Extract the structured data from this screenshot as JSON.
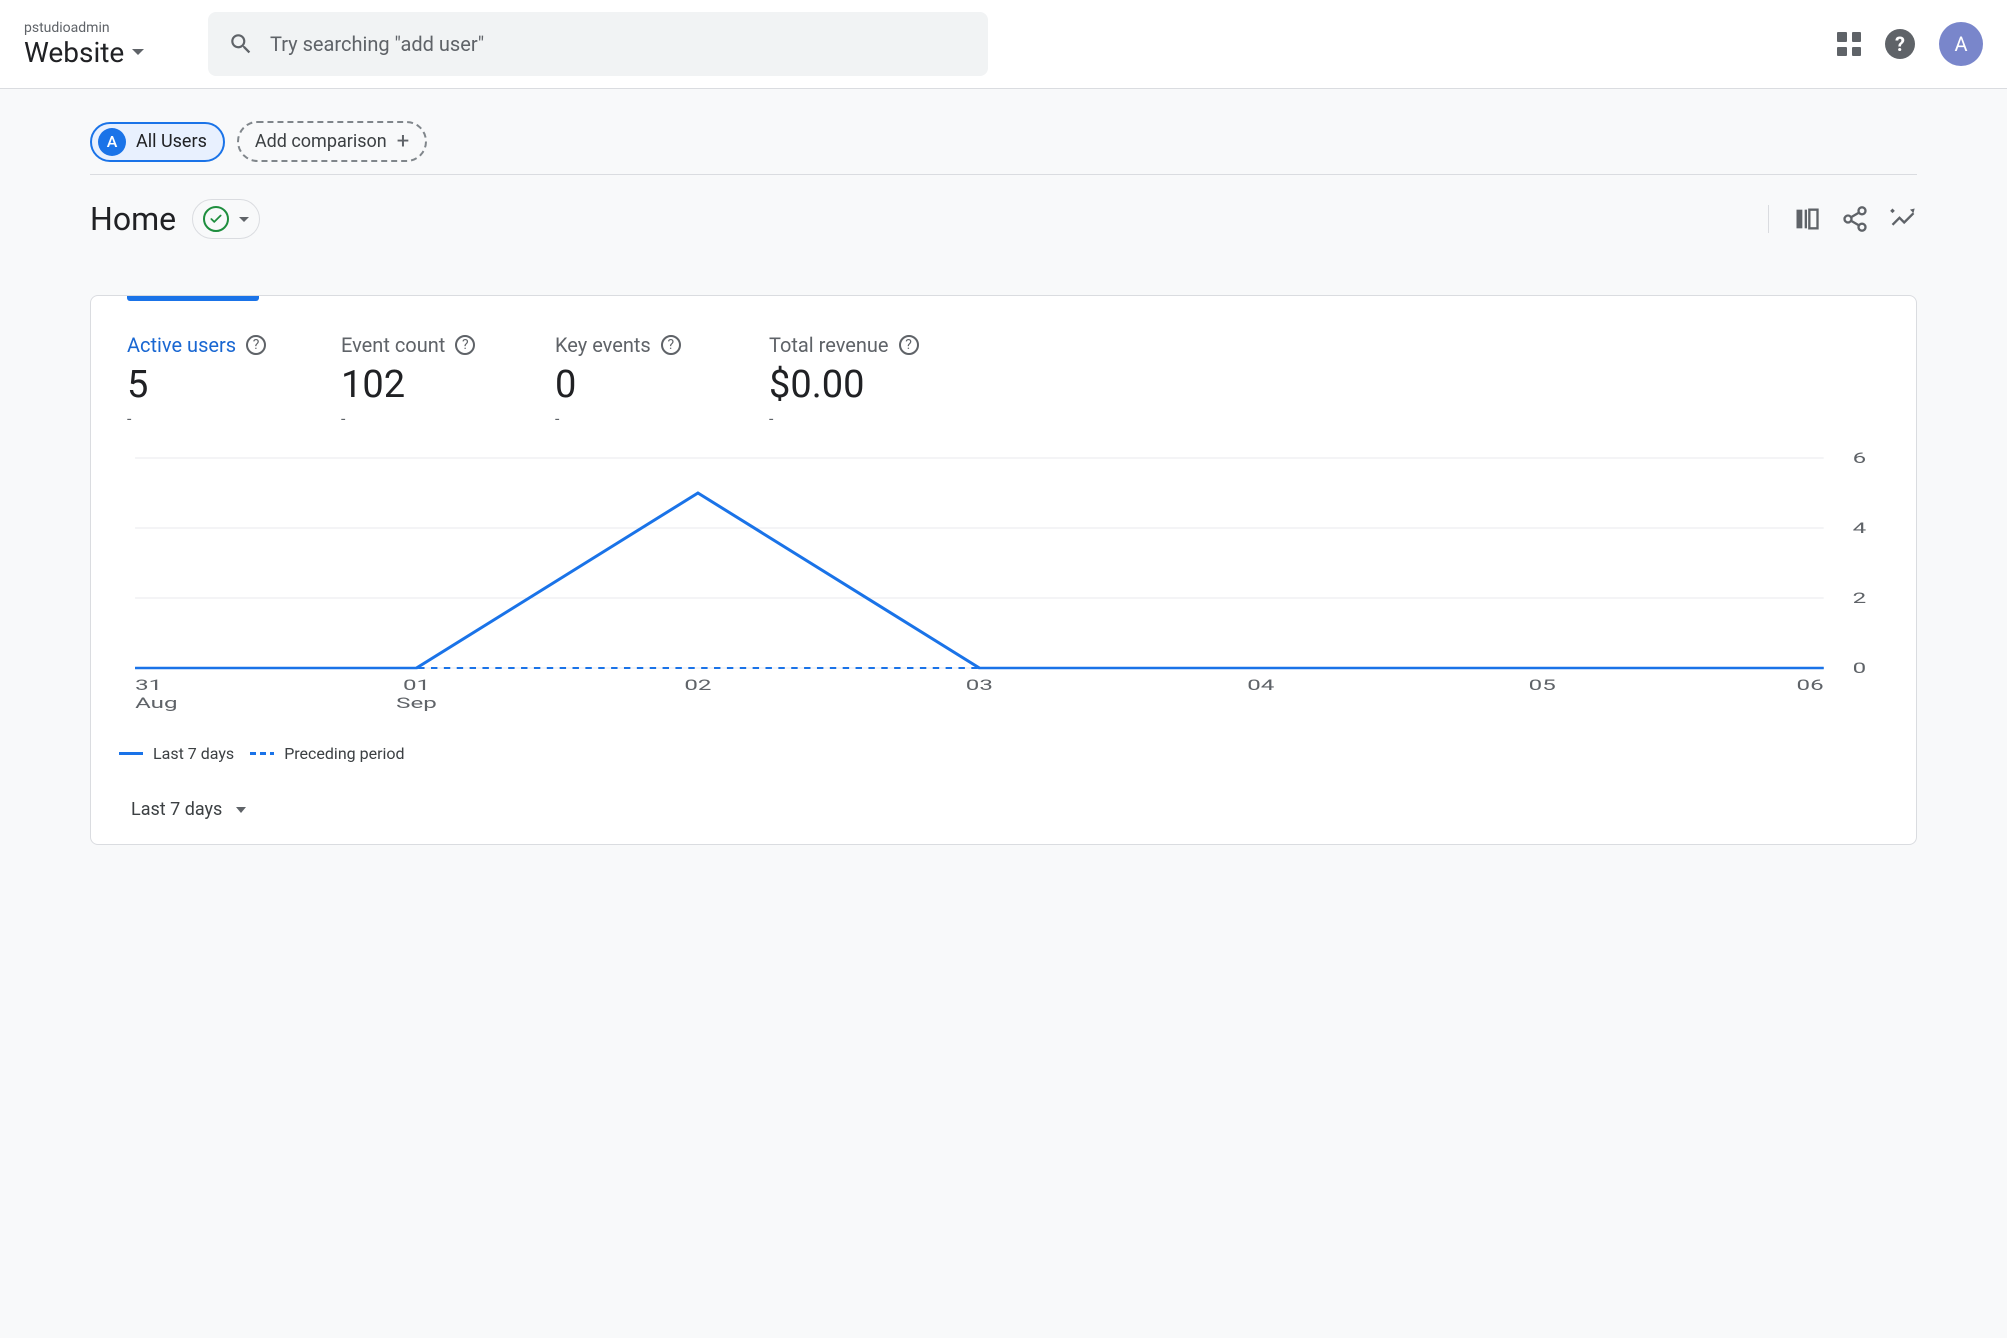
{
  "header": {
    "property_label": "pstudioadmin",
    "property_name": "Website",
    "search_placeholder": "Try searching \"add user\"",
    "avatar_initial": "A"
  },
  "comparison": {
    "all_users_badge": "A",
    "all_users_label": "All Users",
    "add_comparison_label": "Add comparison"
  },
  "page": {
    "title": "Home"
  },
  "metrics": [
    {
      "label": "Active users",
      "value": "5",
      "delta": "-",
      "active": true
    },
    {
      "label": "Event count",
      "value": "102",
      "delta": "-",
      "active": false
    },
    {
      "label": "Key events",
      "value": "0",
      "delta": "-",
      "active": false
    },
    {
      "label": "Total revenue",
      "value": "$0.00",
      "delta": "-",
      "active": false
    }
  ],
  "chart_data": {
    "type": "line",
    "x": [
      "31 Aug",
      "01 Sep",
      "02",
      "03",
      "04",
      "05",
      "06"
    ],
    "series": [
      {
        "name": "Last 7 days",
        "values": [
          0,
          0,
          5,
          0,
          0,
          0,
          0
        ]
      },
      {
        "name": "Preceding period",
        "values": [
          0,
          0,
          0,
          0,
          0,
          0,
          0
        ]
      }
    ],
    "ylabel": "",
    "xlabel": "",
    "ylim": [
      0,
      6
    ],
    "y_ticks": [
      0,
      2,
      4,
      6
    ],
    "x_tick_labels_top": [
      "31",
      "01",
      "02",
      "03",
      "04",
      "05",
      "06"
    ],
    "x_tick_labels_bottom": [
      "Aug",
      "Sep",
      "",
      "",
      "",
      "",
      ""
    ]
  },
  "legend": {
    "current": "Last 7 days",
    "previous": "Preceding period"
  },
  "date_range": "Last 7 days"
}
